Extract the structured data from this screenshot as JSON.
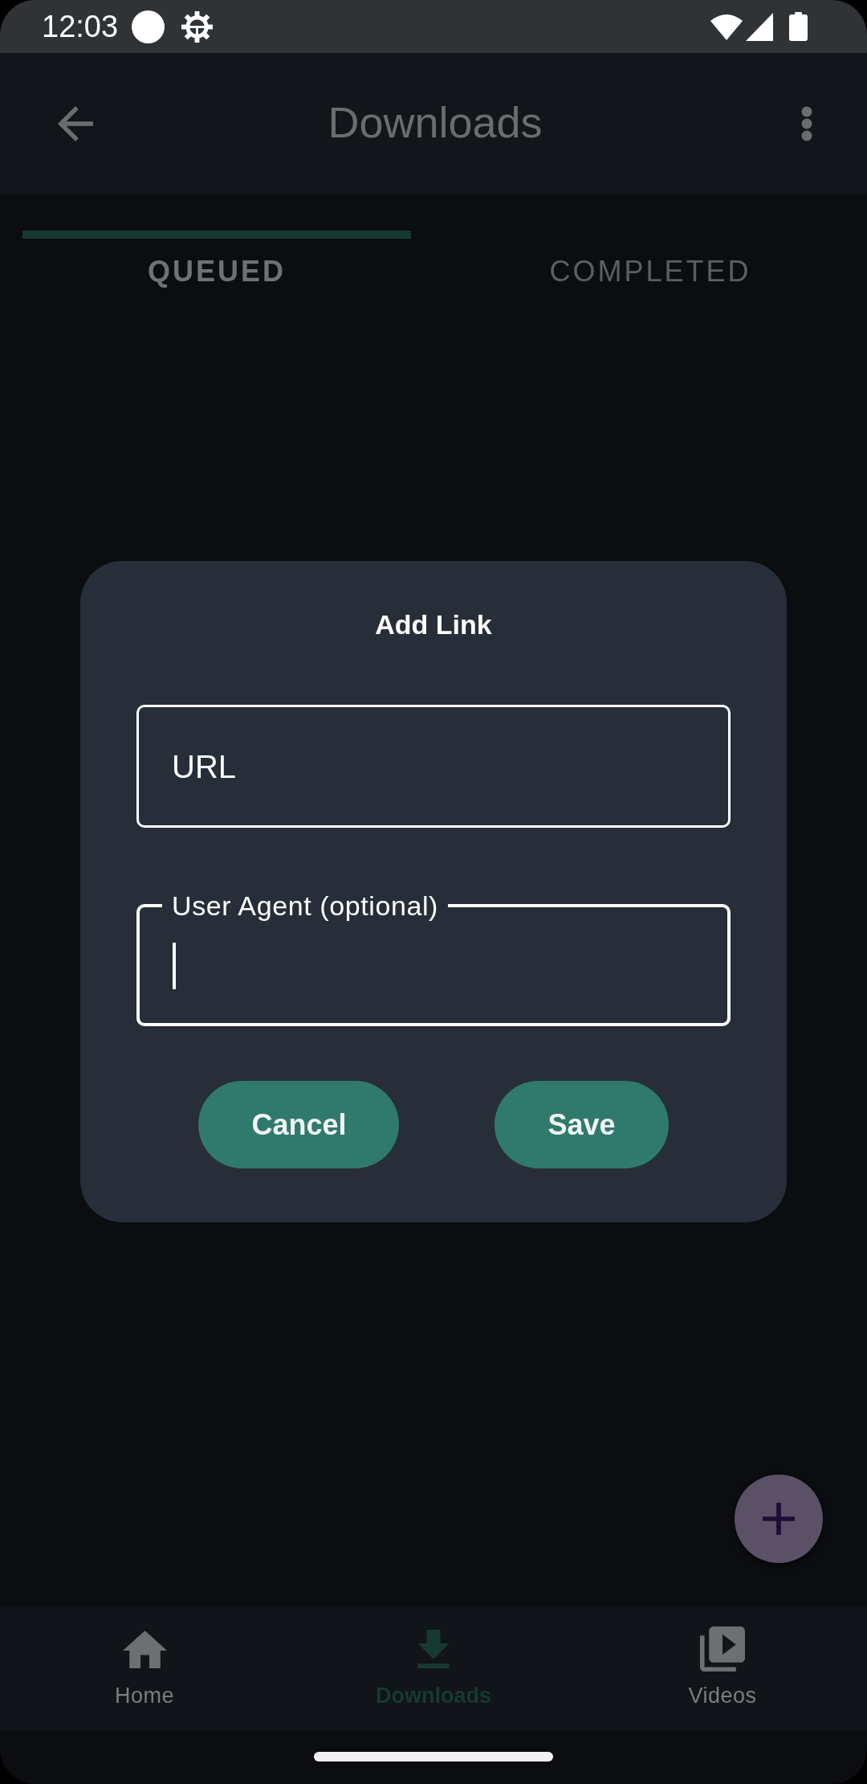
{
  "status_bar": {
    "time": "12:03"
  },
  "app_bar": {
    "title": "Downloads"
  },
  "tabs": [
    {
      "label": "QUEUED",
      "selected": true
    },
    {
      "label": "COMPLETED",
      "selected": false
    }
  ],
  "dialog": {
    "title": "Add Link",
    "fields": [
      {
        "label": "URL",
        "focused": false
      },
      {
        "label": "User Agent (optional)",
        "focused": true
      }
    ],
    "buttons": [
      "Cancel",
      "Save"
    ]
  },
  "bottom_nav": [
    {
      "label": "Home",
      "selected": false
    },
    {
      "label": "Downloads",
      "selected": true
    },
    {
      "label": "Videos",
      "selected": false
    }
  ]
}
